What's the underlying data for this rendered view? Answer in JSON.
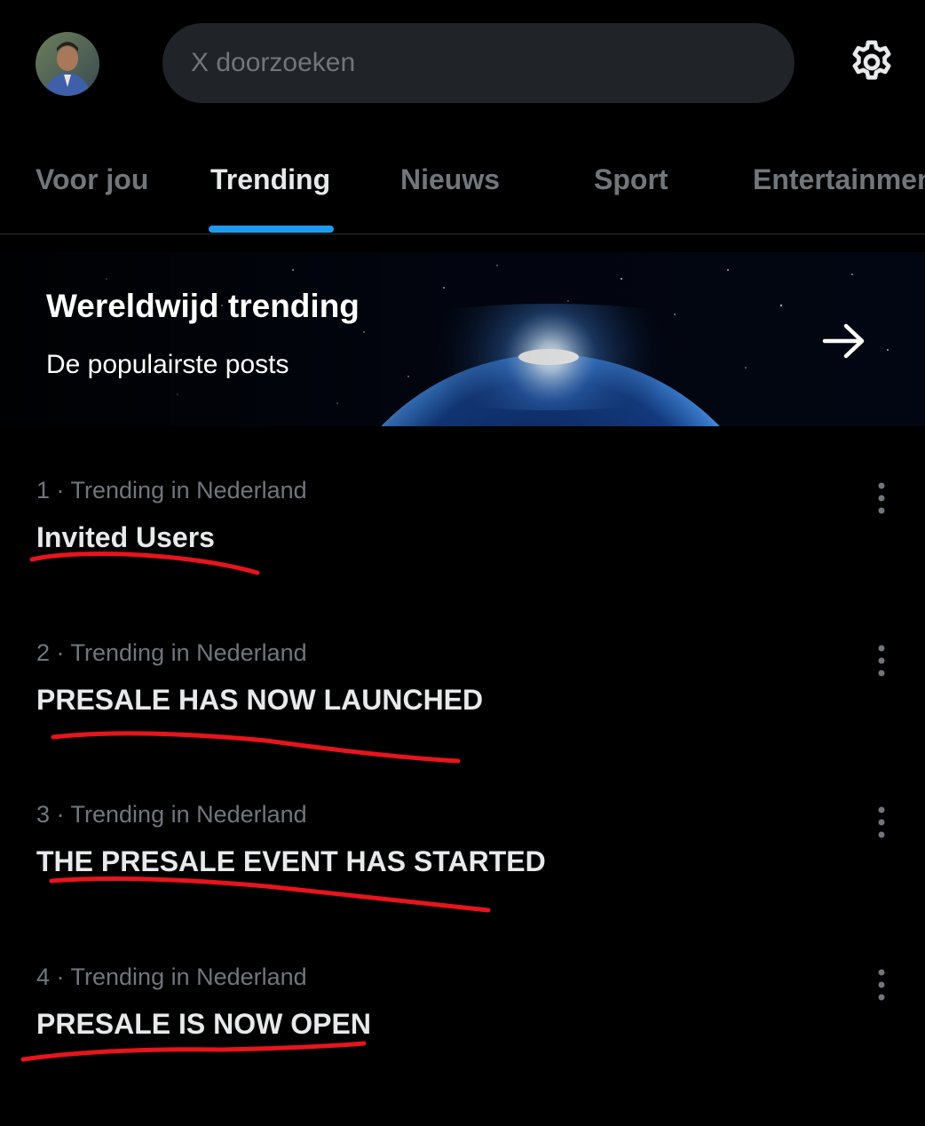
{
  "header": {
    "search_placeholder": "X doorzoeken",
    "avatar_icon": "user-avatar",
    "settings_icon": "gear-icon"
  },
  "tabs": [
    {
      "label": "Voor jou",
      "active": false
    },
    {
      "label": "Trending",
      "active": true
    },
    {
      "label": "Nieuws",
      "active": false
    },
    {
      "label": "Sport",
      "active": false
    },
    {
      "label": "Entertainment",
      "active": false
    }
  ],
  "banner": {
    "title": "Wereldwijd trending",
    "subtitle": "De populairste posts",
    "arrow_icon": "arrow-right-icon"
  },
  "trends": [
    {
      "meta": "1 · Trending in Nederland",
      "title": "Invited Users"
    },
    {
      "meta": "2 · Trending in Nederland",
      "title": "PRESALE HAS NOW LAUNCHED"
    },
    {
      "meta": "3 · Trending in Nederland",
      "title": "THE PRESALE EVENT HAS STARTED"
    },
    {
      "meta": "4 · Trending in Nederland",
      "title": "PRESALE IS NOW OPEN"
    }
  ],
  "colors": {
    "background": "#000000",
    "accent": "#1d9bf0",
    "text_primary": "#e7e9ea",
    "text_secondary": "#71767b",
    "annotation": "#e8141c"
  }
}
